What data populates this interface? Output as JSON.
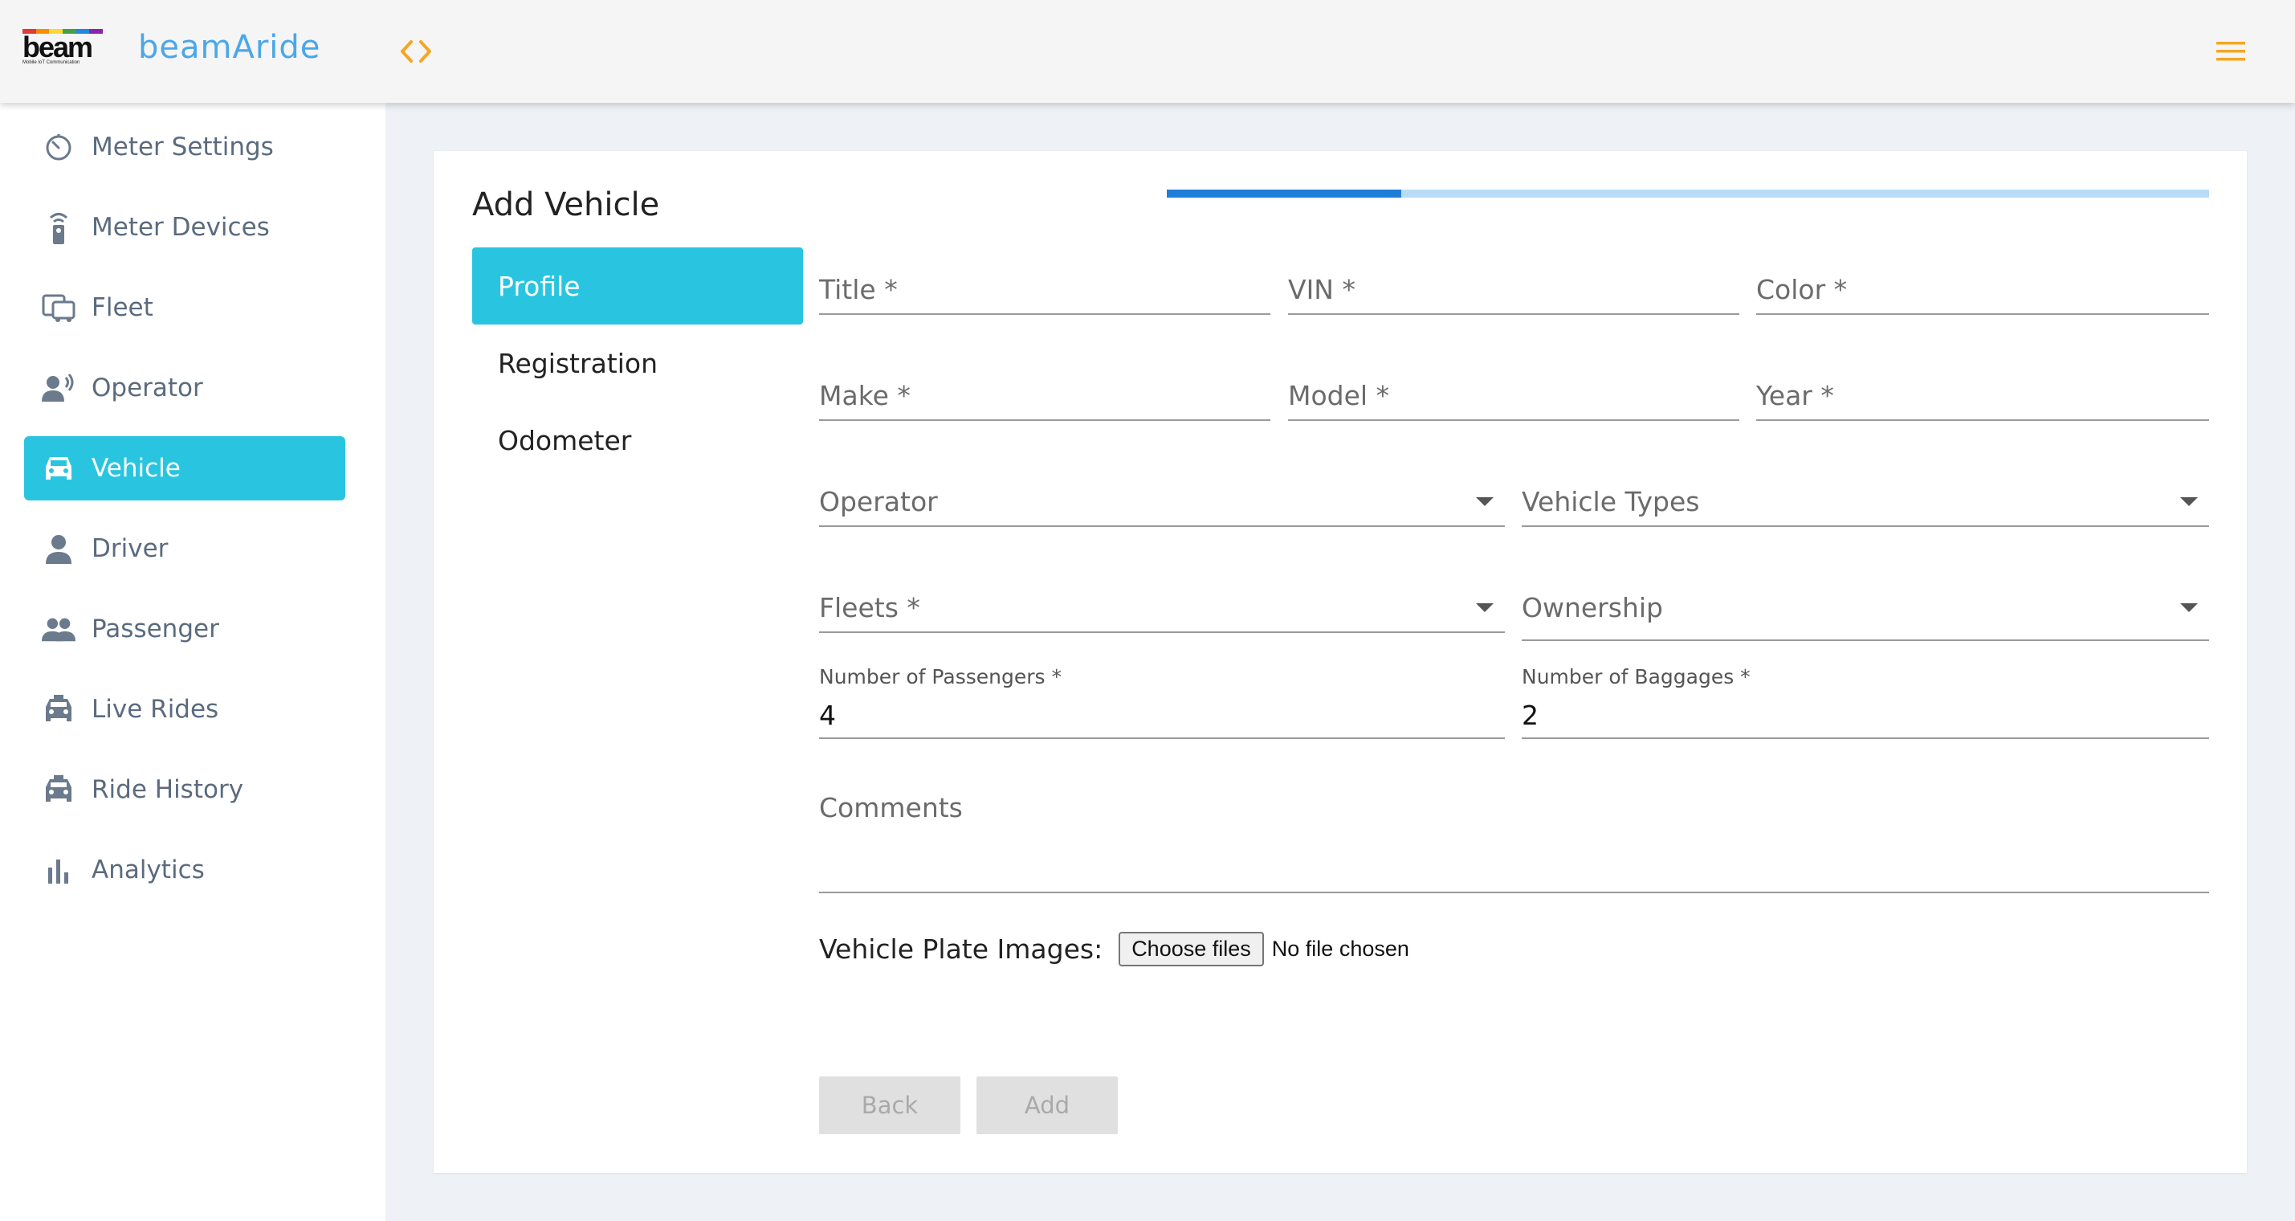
{
  "header": {
    "logo_word": "beam",
    "logo_tagline": "Mobile IoT Communication",
    "app_title": "beamAride",
    "brand_color": "#4aa7e8",
    "accent_color": "#f5a623",
    "icons": {
      "toggle": "code-brackets-icon",
      "menu": "hamburger-menu-icon"
    }
  },
  "sidebar": {
    "items": [
      {
        "label": "Meter Settings",
        "icon": "meter-dial-icon",
        "active": false
      },
      {
        "label": "Meter Devices",
        "icon": "remote-device-icon",
        "active": false
      },
      {
        "label": "Fleet",
        "icon": "bus-icon",
        "active": false
      },
      {
        "label": "Operator",
        "icon": "record-voice-icon",
        "active": false
      },
      {
        "label": "Vehicle",
        "icon": "car-icon",
        "active": true
      },
      {
        "label": "Driver",
        "icon": "person-icon",
        "active": false
      },
      {
        "label": "Passenger",
        "icon": "people-icon",
        "active": false
      },
      {
        "label": "Live Rides",
        "icon": "taxi-icon",
        "active": false
      },
      {
        "label": "Ride History",
        "icon": "taxi-icon",
        "active": false
      },
      {
        "label": "Analytics",
        "icon": "bar-chart-icon",
        "active": false
      }
    ],
    "active_color": "#29c5e0"
  },
  "form": {
    "title": "Add Vehicle",
    "progress_fraction": 0.225,
    "steps": [
      {
        "label": "Profile",
        "active": true
      },
      {
        "label": "Registration",
        "active": false
      },
      {
        "label": "Odometer",
        "active": false
      }
    ],
    "fields": {
      "title": {
        "label": "Title *"
      },
      "vin": {
        "label": "VIN *"
      },
      "color": {
        "label": "Color *"
      },
      "make": {
        "label": "Make *"
      },
      "model": {
        "label": "Model *"
      },
      "year": {
        "label": "Year *"
      },
      "operator": {
        "label": "Operator"
      },
      "vehicle_types": {
        "label": "Vehicle Types"
      },
      "fleets": {
        "label": "Fleets *"
      },
      "ownership": {
        "label": "Ownership"
      },
      "passengers": {
        "label": "Number of Passengers *",
        "value": "4"
      },
      "baggages": {
        "label": "Number of Baggages *",
        "value": "2"
      },
      "comments": {
        "label": "Comments"
      }
    },
    "plate_images": {
      "label": "Vehicle Plate Images:",
      "button": "Choose files",
      "status": "No file chosen"
    },
    "buttons": {
      "back": "Back",
      "add": "Add"
    }
  }
}
